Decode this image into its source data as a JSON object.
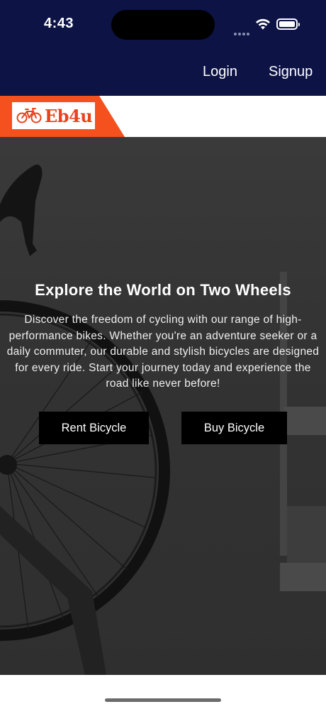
{
  "status_bar": {
    "time": "4:43"
  },
  "nav": {
    "login_label": "Login",
    "signup_label": "Signup"
  },
  "logo": {
    "text": "Eb4u",
    "icon": "bicycle-icon",
    "accent_color": "#f4511e"
  },
  "hero": {
    "title": "Explore the World on Two Wheels",
    "description": "Discover the freedom of cycling with our range of high-performance bikes. Whether you're an adventure seeker or a daily commuter, our durable and stylish bicycles are designed for every ride. Start your journey today and experience the road like never before!",
    "buttons": {
      "rent_label": "Rent Bicycle",
      "buy_label": "Buy Bicycle"
    }
  },
  "colors": {
    "header_bg": "#0d1445",
    "button_bg": "#000000"
  }
}
